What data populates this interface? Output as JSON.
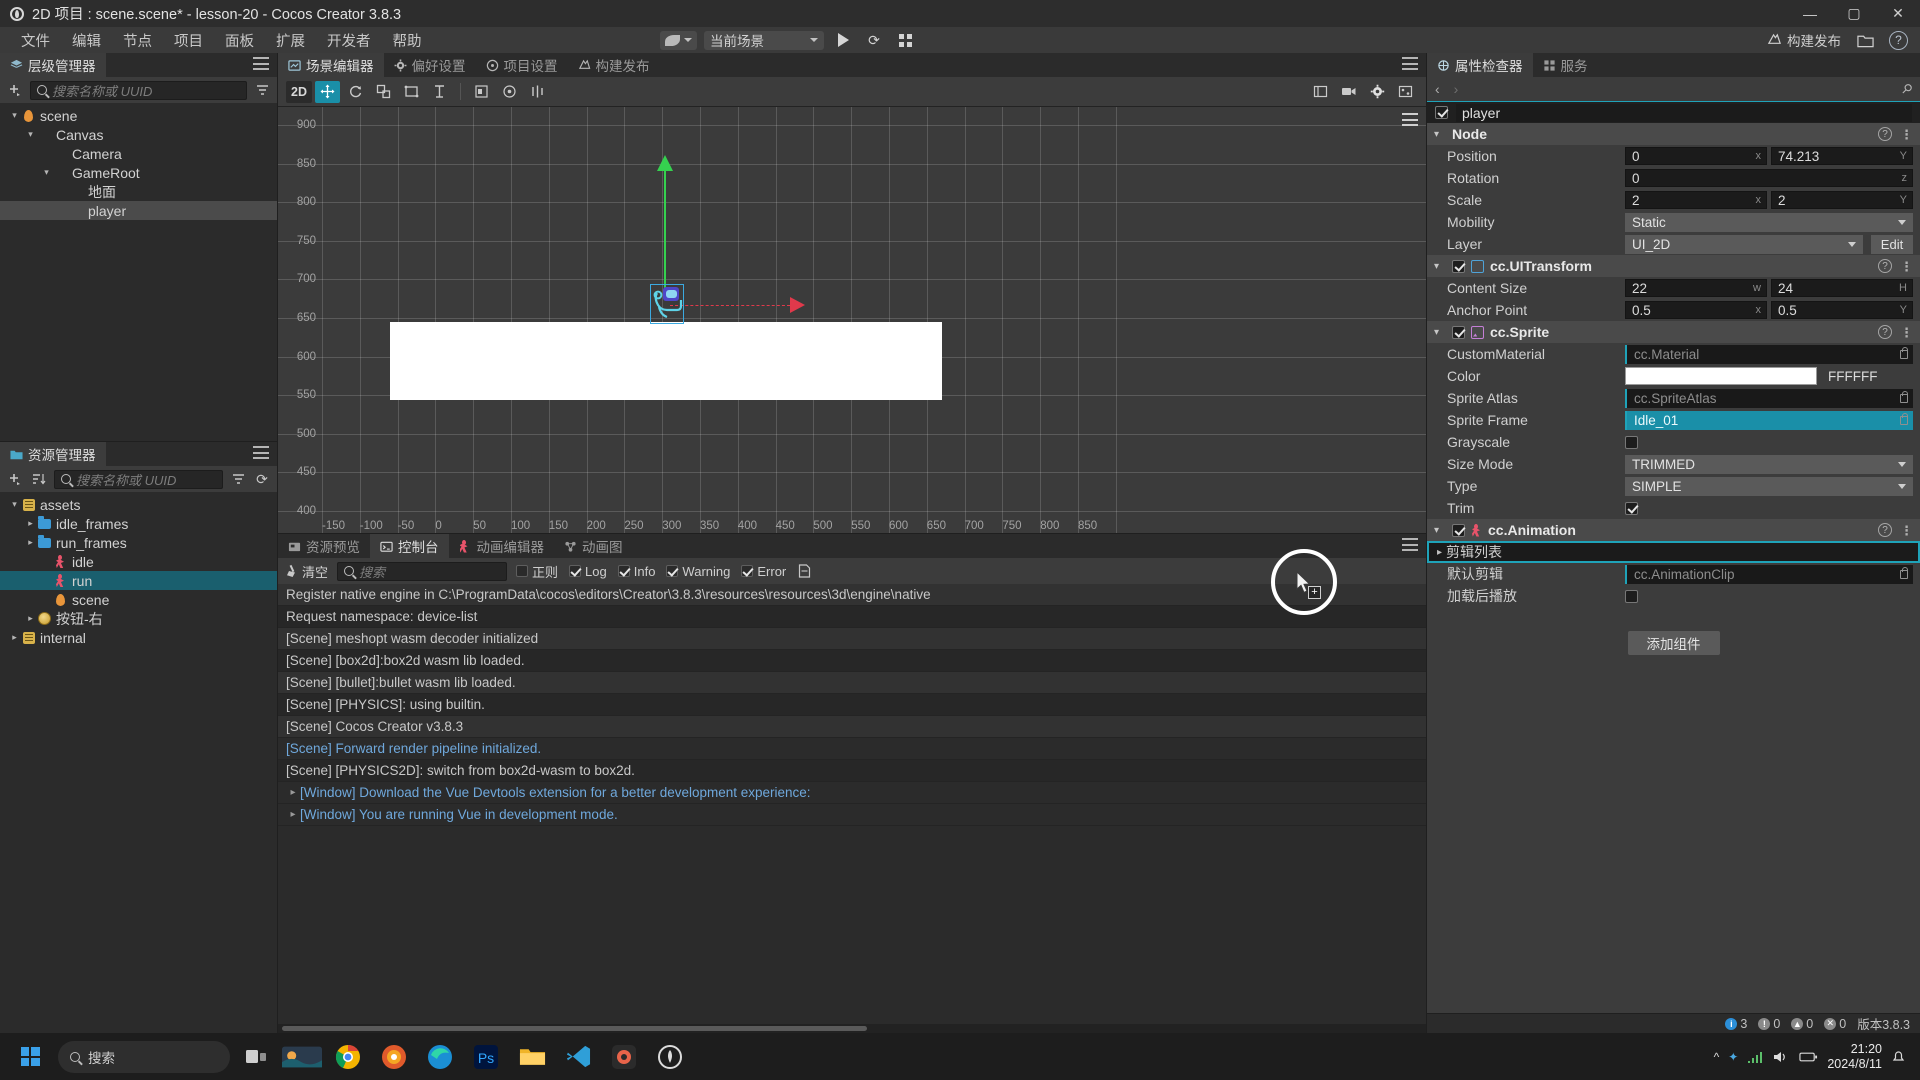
{
  "titlebar": {
    "logo_icon": "cocos-logo-icon",
    "title": "2D 项目 : scene.scene* - lesson-20 - Cocos Creator 3.8.3",
    "minimize": "—",
    "maximize": "▢",
    "close": "✕"
  },
  "menubar": {
    "items": [
      "文件",
      "编辑",
      "节点",
      "项目",
      "面板",
      "扩展",
      "开发者",
      "帮助"
    ],
    "scene_select": "当前场景",
    "play_icon": "play-icon",
    "refresh_icon": "refresh-icon",
    "grid_icon": "device-grid-icon",
    "build_label": "构建发布",
    "folder_icon": "folder-icon",
    "help_icon": "help-icon"
  },
  "hierarchy": {
    "tab_label": "层级管理器",
    "tab_icon": "layers-icon",
    "add_icon": "add-node-icon",
    "filter_icon": "filter-icon",
    "menu_icon": "hamburger-icon",
    "search_placeholder": "搜索名称或 UUID",
    "nodes": [
      {
        "label": "scene",
        "depth": 0,
        "icon": "flame-icon",
        "arrow": "v",
        "selected": false
      },
      {
        "label": "Canvas",
        "depth": 1,
        "icon": "none",
        "arrow": "v",
        "selected": false
      },
      {
        "label": "Camera",
        "depth": 2,
        "icon": "none",
        "arrow": "",
        "selected": false
      },
      {
        "label": "GameRoot",
        "depth": 2,
        "icon": "none",
        "arrow": "v",
        "selected": false
      },
      {
        "label": "地面",
        "depth": 3,
        "icon": "none",
        "arrow": "",
        "selected": false
      },
      {
        "label": "player",
        "depth": 3,
        "icon": "none",
        "arrow": "",
        "selected": true
      }
    ]
  },
  "assets": {
    "tab_label": "资源管理器",
    "tab_icon": "folder-icon",
    "add_icon": "add-asset-icon",
    "sort_icon": "sort-icon",
    "menu_icon": "hamburger-icon",
    "refresh_icon": "refresh-icon",
    "search_placeholder": "搜索名称或 UUID",
    "nodes": [
      {
        "label": "assets",
        "depth": 0,
        "icon": "assets-db-icon",
        "arrow": "v",
        "selected": false
      },
      {
        "label": "idle_frames",
        "depth": 1,
        "icon": "folder-icon",
        "arrow": ">",
        "selected": false
      },
      {
        "label": "run_frames",
        "depth": 1,
        "icon": "folder-icon",
        "arrow": ">",
        "selected": false
      },
      {
        "label": "idle",
        "depth": 2,
        "icon": "animation-icon",
        "arrow": "",
        "selected": false
      },
      {
        "label": "run",
        "depth": 2,
        "icon": "animation-icon",
        "arrow": "",
        "selected": true
      },
      {
        "label": "scene",
        "depth": 2,
        "icon": "flame-icon",
        "arrow": "",
        "selected": false
      },
      {
        "label": "按钮-右",
        "depth": 1,
        "icon": "prefab-icon",
        "arrow": ">",
        "selected": false
      },
      {
        "label": "internal",
        "depth": 0,
        "icon": "assets-db-icon",
        "arrow": ">",
        "selected": false
      }
    ]
  },
  "scene_panel": {
    "tabs": [
      {
        "label": "场景编辑器",
        "icon": "scene-icon",
        "active": true
      },
      {
        "label": "偏好设置",
        "icon": "gear-icon",
        "active": false
      },
      {
        "label": "项目设置",
        "icon": "project-icon",
        "active": false
      },
      {
        "label": "构建发布",
        "icon": "build-icon",
        "active": false
      }
    ],
    "menu_icon": "hamburger-icon",
    "toolbar": {
      "mode_label": "2D",
      "tools": [
        "move-tool-icon",
        "rotate-tool-icon",
        "scale-tool-icon",
        "rect-tool-icon",
        "position-tool-icon"
      ],
      "align_tools": [
        "align-left-icon",
        "align-center-icon",
        "distribute-icon"
      ],
      "right_tools": [
        "layout-icon",
        "camera-icon",
        "gear-icon",
        "effects-icon"
      ],
      "active_tool": "move-tool-icon"
    },
    "ruler_v": [
      "900",
      "850",
      "800",
      "750",
      "700",
      "650",
      "600",
      "550",
      "500",
      "450",
      "400"
    ],
    "ruler_h": [
      "-150",
      "-100",
      "-50",
      "0",
      "50",
      "100",
      "150",
      "200",
      "250",
      "300",
      "350",
      "400",
      "450",
      "500",
      "550",
      "600",
      "650",
      "700",
      "750",
      "800",
      "850"
    ],
    "gizmo": {
      "y_axis_color": "#35d14f",
      "x_axis_color": "#e0394b",
      "selection_color": "#3ba9e0"
    },
    "ground_color": "#ffffff"
  },
  "console": {
    "tabs": [
      {
        "label": "资源预览",
        "icon": "preview-icon",
        "active": false
      },
      {
        "label": "控制台",
        "icon": "console-icon",
        "active": true
      },
      {
        "label": "动画编辑器",
        "icon": "animation-icon",
        "active": false
      },
      {
        "label": "动画图",
        "icon": "anim-graph-icon",
        "active": false
      }
    ],
    "menu_icon": "hamburger-icon",
    "clear_label": "清空",
    "clear_icon": "broom-icon",
    "search_placeholder": "搜索",
    "filters": [
      {
        "label": "正则",
        "checked": false
      },
      {
        "label": "Log",
        "checked": true
      },
      {
        "label": "Info",
        "checked": true
      },
      {
        "label": "Warning",
        "checked": true
      },
      {
        "label": "Error",
        "checked": true
      }
    ],
    "export_icon": "export-icon",
    "messages": [
      {
        "text": "Register native engine in C:\\ProgramData\\cocos\\editors\\Creator\\3.8.3\\resources\\resources\\3d\\engine\\native",
        "style": "alt",
        "expand": false
      },
      {
        "text": "Request namespace: device-list",
        "style": "dark",
        "expand": false
      },
      {
        "text": "[Scene] meshopt wasm decoder initialized",
        "style": "alt",
        "expand": false
      },
      {
        "text": "[Scene] [box2d]:box2d wasm lib loaded.",
        "style": "dark",
        "expand": false
      },
      {
        "text": "[Scene] [bullet]:bullet wasm lib loaded.",
        "style": "alt",
        "expand": false
      },
      {
        "text": "[Scene] [PHYSICS]: using builtin.",
        "style": "dark",
        "expand": false
      },
      {
        "text": "[Scene] Cocos Creator v3.8.3",
        "style": "alt",
        "expand": false
      },
      {
        "text": "[Scene] Forward render pipeline initialized.",
        "style": "link",
        "expand": false
      },
      {
        "text": "[Scene] [PHYSICS2D]: switch from box2d-wasm to box2d.",
        "style": "dark",
        "expand": false
      },
      {
        "text": "[Window] Download the Vue Devtools extension for a better development experience:",
        "style": "link",
        "expand": true
      },
      {
        "text": "[Window] You are running Vue in development mode.",
        "style": "link",
        "expand": true
      }
    ]
  },
  "inspector": {
    "tabs": [
      {
        "label": "属性检查器",
        "icon": "inspector-icon",
        "active": true
      },
      {
        "label": "服务",
        "icon": "services-icon",
        "active": false
      }
    ],
    "back_icon": "chevron-left-icon",
    "forward_icon": "chevron-right-icon",
    "pin_icon": "pin-icon",
    "node_name": "player",
    "node_enabled": true,
    "sections": [
      {
        "title": "Node",
        "has_checkbox": false,
        "icon": "none",
        "rows": [
          {
            "label": "Position",
            "type": "vec2",
            "values": [
              "0",
              "74.213"
            ],
            "suffixes": [
              "x",
              "Y"
            ]
          },
          {
            "label": "Rotation",
            "type": "single",
            "values": [
              "0"
            ],
            "suffixes": [
              "z"
            ]
          },
          {
            "label": "Scale",
            "type": "vec2",
            "values": [
              "2",
              "2"
            ],
            "suffixes": [
              "x",
              "Y"
            ]
          },
          {
            "label": "Mobility",
            "type": "select",
            "values": [
              "Static"
            ],
            "suffixes": []
          },
          {
            "label": "Layer",
            "type": "select_edit",
            "values": [
              "UI_2D"
            ],
            "suffixes": [],
            "button": "Edit"
          }
        ]
      },
      {
        "title": "cc.UITransform",
        "has_checkbox": true,
        "icon": "uitransform-icon",
        "rows": [
          {
            "label": "Content Size",
            "type": "vec2",
            "values": [
              "22",
              "24"
            ],
            "suffixes": [
              "w",
              "H"
            ]
          },
          {
            "label": "Anchor Point",
            "type": "vec2",
            "values": [
              "0.5",
              "0.5"
            ],
            "suffixes": [
              "x",
              "Y"
            ]
          }
        ]
      },
      {
        "title": "cc.Sprite",
        "has_checkbox": true,
        "icon": "sprite-icon",
        "rows": [
          {
            "label": "CustomMaterial",
            "type": "asset",
            "values": [
              "cc.Material"
            ],
            "filled": false
          },
          {
            "label": "Color",
            "type": "color",
            "values": [
              "FFFFFF"
            ],
            "swatch": "#ffffff"
          },
          {
            "label": "Sprite Atlas",
            "type": "asset",
            "values": [
              "cc.SpriteAtlas"
            ],
            "filled": false
          },
          {
            "label": "Sprite Frame",
            "type": "asset",
            "values": [
              "Idle_01"
            ],
            "filled": true
          },
          {
            "label": "Grayscale",
            "type": "checkbox",
            "values": [],
            "checked": false
          },
          {
            "label": "Size Mode",
            "type": "select",
            "values": [
              "TRIMMED"
            ]
          },
          {
            "label": "Type",
            "type": "select",
            "values": [
              "SIMPLE"
            ]
          },
          {
            "label": "Trim",
            "type": "checkbox",
            "values": [],
            "checked": true
          }
        ]
      },
      {
        "title": "cc.Animation",
        "has_checkbox": true,
        "icon": "animation-icon",
        "rows": [
          {
            "label": "剪辑列表",
            "type": "droptarget",
            "values": [
              ""
            ],
            "highlighted": true
          },
          {
            "label": "默认剪辑",
            "type": "asset",
            "values": [
              "cc.AnimationClip"
            ],
            "filled": false
          },
          {
            "label": "加载后播放",
            "type": "checkbox",
            "values": [],
            "checked": false
          }
        ]
      }
    ],
    "add_component_label": "添加组件"
  },
  "statusbar": {
    "info_count": "3",
    "log_count": "0",
    "warn_count": "0",
    "error_count": "0",
    "version_label": "版本3.8.3"
  },
  "taskbar": {
    "start_icon": "windows-start-icon",
    "search_placeholder": "搜索",
    "search_icon": "search-icon",
    "apps": [
      "task-view-icon",
      "weather-widget-icon",
      "chrome-icon",
      "firefox-icon",
      "edge-icon",
      "photoshop-icon",
      "explorer-icon",
      "vscode-icon",
      "cocos-dashboard-icon",
      "cocos-creator-icon"
    ],
    "tray_icons": [
      "chevron-up-icon",
      "bluetooth-icon",
      "network-icon",
      "volume-icon",
      "battery-icon",
      "notification-icon"
    ],
    "time": "21:20",
    "date": "2024/8/11"
  },
  "colors": {
    "accent_teal": "#1a8fa8",
    "panel_bg": "#3c3c3c",
    "dark_bg": "#2b2b2b",
    "selection": "#4b4b4b"
  }
}
